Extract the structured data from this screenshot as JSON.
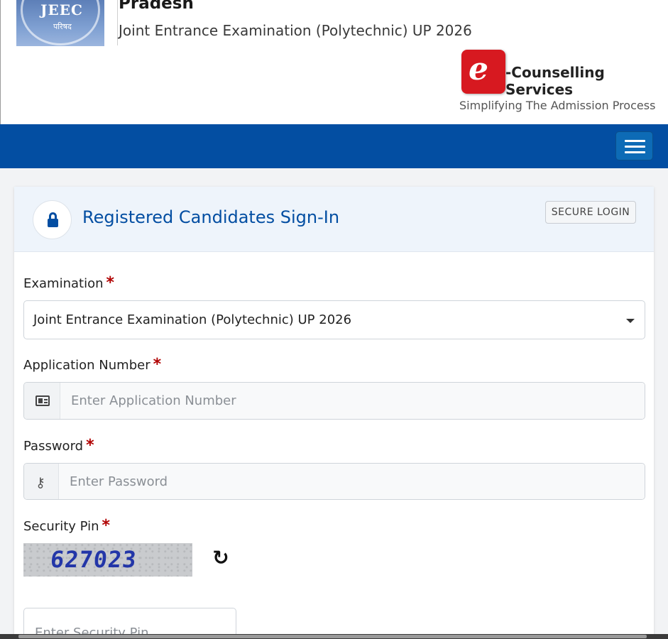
{
  "header": {
    "logo_text": "JEEC",
    "logo_sub": "परिषद",
    "org_title": "Pradesh",
    "exam_title": "Joint Entrance Examination (Polytechnic) UP 2026",
    "brand_letter": "e",
    "brand_title": "-Counselling Services",
    "brand_tagline": "Simplifying The Admission Process",
    "brand_color": "#d71920"
  },
  "navbar": {
    "color": "#034ea2",
    "toggle_icon": "hamburger-menu-icon"
  },
  "card": {
    "title": "Registered Candidates Sign-In",
    "badge": "SECURE LOGIN",
    "lock_icon": "lock-icon"
  },
  "form": {
    "examination": {
      "label": "Examination",
      "required_mark": "*",
      "selected": "Joint Entrance Examination (Polytechnic) UP 2026"
    },
    "application_number": {
      "label": "Application Number",
      "required_mark": "*",
      "placeholder": "Enter Application Number",
      "icon": "id-card-icon"
    },
    "password": {
      "label": "Password",
      "required_mark": "*",
      "placeholder": "Enter Password",
      "icon": "key-icon"
    },
    "security_pin": {
      "label": "Security Pin",
      "required_mark": "*",
      "captcha_text": "627023",
      "refresh_icon": "refresh-icon",
      "placeholder": "Enter Security Pin"
    }
  }
}
